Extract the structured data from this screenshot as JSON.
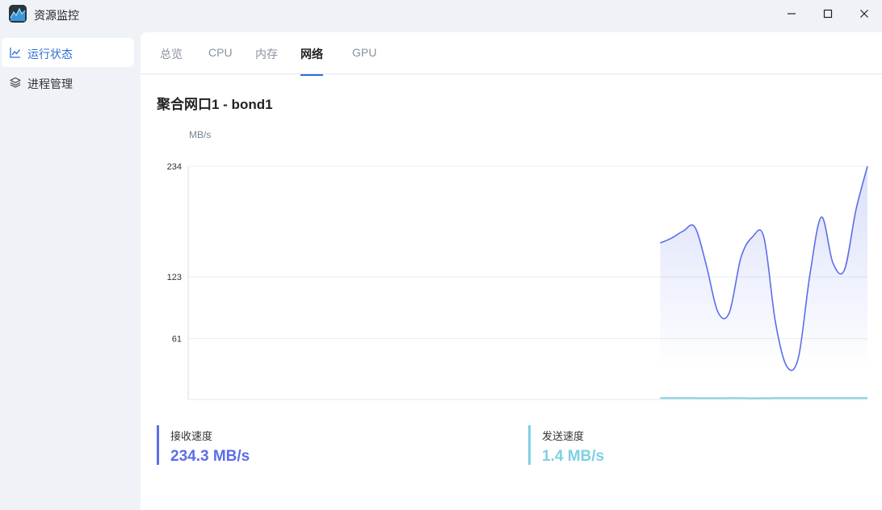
{
  "app": {
    "title": "资源监控"
  },
  "sidebar": {
    "items": [
      {
        "label": "运行状态",
        "icon": "line-chart-icon",
        "active": true
      },
      {
        "label": "进程管理",
        "icon": "layers-icon",
        "active": false
      }
    ]
  },
  "tabs": [
    {
      "label": "总览",
      "active": false
    },
    {
      "label": "CPU",
      "active": false
    },
    {
      "label": "内存",
      "active": false
    },
    {
      "label": "网络",
      "active": true
    },
    {
      "label": "GPU",
      "active": false
    }
  ],
  "section": {
    "title": "聚合网口1 - bond1"
  },
  "colors": {
    "receive": "#5b6ee8",
    "send": "#7fd0e3",
    "accent": "#2e6fd8"
  },
  "stats": {
    "receive": {
      "label": "接收速度",
      "value": "234.3 MB/s"
    },
    "send": {
      "label": "发送速度",
      "value": "1.4 MB/s"
    }
  },
  "chart_data": {
    "type": "area",
    "ylabel": "MB/s",
    "ylim": [
      0,
      234
    ],
    "yticks": [
      61,
      123,
      234
    ],
    "grid": true,
    "total_samples": 60,
    "series": [
      {
        "name": "接收速度",
        "values": [
          157,
          162,
          169,
          173,
          135,
          88,
          87,
          142,
          163,
          163,
          78,
          33,
          42,
          125,
          183,
          137,
          130,
          190,
          234
        ]
      },
      {
        "name": "发送速度",
        "values": [
          1.4,
          1.4,
          1.4,
          1.4,
          1.3,
          1.3,
          1.4,
          1.4,
          1.2,
          1.3,
          1.4,
          1.4,
          1.4,
          1.4,
          1.4,
          1.4,
          1.4,
          1.4,
          1.4
        ]
      }
    ]
  }
}
